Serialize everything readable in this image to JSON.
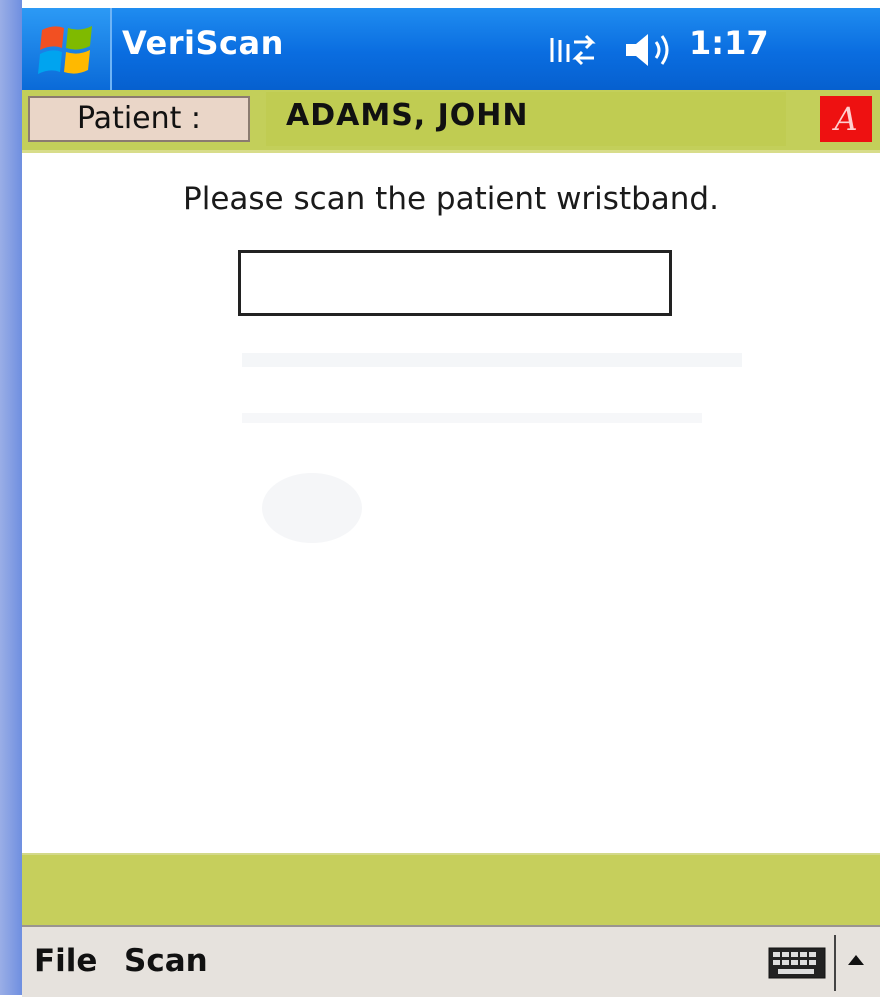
{
  "titlebar": {
    "start_icon": "windows-flag-icon",
    "app_title": "VeriScan",
    "connectivity_icon": "connectivity-arrows-icon",
    "speaker_icon": "speaker-icon",
    "time": "1:17"
  },
  "patient_bar": {
    "button_label": "Patient :",
    "patient_name": "ADAMS, JOHN",
    "alert_badge": "A"
  },
  "main": {
    "prompt": "Please scan the patient wristband.",
    "scan_input_value": ""
  },
  "menu": {
    "items": [
      {
        "label": "File"
      },
      {
        "label": "Scan"
      }
    ],
    "keyboard_icon": "keyboard-icon",
    "sip_arrow_icon": "up-arrow-icon"
  },
  "colors": {
    "titlebar_blue": "#0a6de0",
    "patient_bar_olive": "#c3cf5a",
    "alert_red": "#ee1111",
    "menu_bar_gray": "#e6e2dd"
  }
}
